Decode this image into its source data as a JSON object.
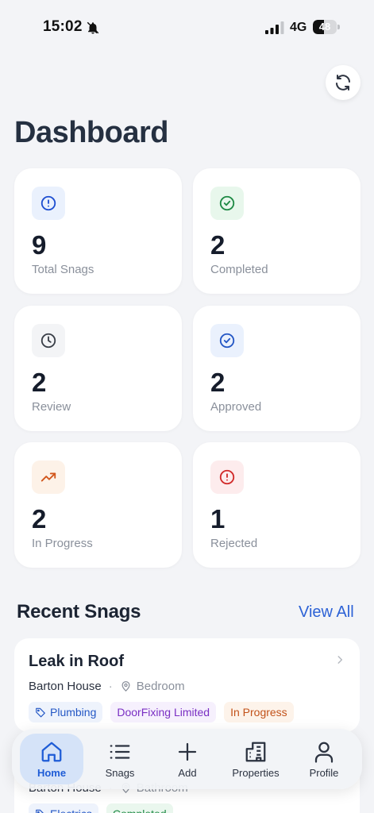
{
  "status_bar": {
    "time": "15:02",
    "network": "4G",
    "battery": "48",
    "battery_level": 0.48
  },
  "page": {
    "title": "Dashboard"
  },
  "stats": [
    {
      "value": "9",
      "label": "Total Snags",
      "icon": "alert-circle-icon",
      "color": "#1e4fd1",
      "bg": "#eaf1fd"
    },
    {
      "value": "2",
      "label": "Completed",
      "icon": "check-circle-icon",
      "color": "#1f8a45",
      "bg": "#e8f7ec"
    },
    {
      "value": "2",
      "label": "Review",
      "icon": "clock-icon",
      "color": "#3a3f48",
      "bg": "#f3f4f6"
    },
    {
      "value": "2",
      "label": "Approved",
      "icon": "check-circle-icon",
      "color": "#2457c5",
      "bg": "#eaf1fd"
    },
    {
      "value": "2",
      "label": "In Progress",
      "icon": "trending-up-icon",
      "color": "#d2561b",
      "bg": "#fdf2e8"
    },
    {
      "value": "1",
      "label": "Rejected",
      "icon": "alert-circle-icon",
      "color": "#d12a2a",
      "bg": "#fdeced"
    }
  ],
  "recent": {
    "title": "Recent Snags",
    "view_all": "View All",
    "snags": [
      {
        "title": "Leak in Roof",
        "property": "Barton House",
        "room": "Bedroom",
        "tags": [
          {
            "label": "Plumbing",
            "style": "blue"
          },
          {
            "label": "DoorFixing Limited",
            "style": "purple"
          },
          {
            "label": "In Progress",
            "style": "orange"
          }
        ]
      },
      {
        "title": "",
        "property": "Barton House",
        "room": "Bathroom",
        "tags": [
          {
            "label": "Electrics",
            "style": "blue"
          },
          {
            "label": "Completed",
            "style": "green"
          }
        ]
      }
    ]
  },
  "nav": [
    {
      "label": "Home",
      "icon": "home-icon",
      "active": true
    },
    {
      "label": "Snags",
      "icon": "list-icon",
      "active": false
    },
    {
      "label": "Add",
      "icon": "plus-icon",
      "active": false
    },
    {
      "label": "Properties",
      "icon": "building-icon",
      "active": false
    },
    {
      "label": "Profile",
      "icon": "user-icon",
      "active": false
    }
  ]
}
